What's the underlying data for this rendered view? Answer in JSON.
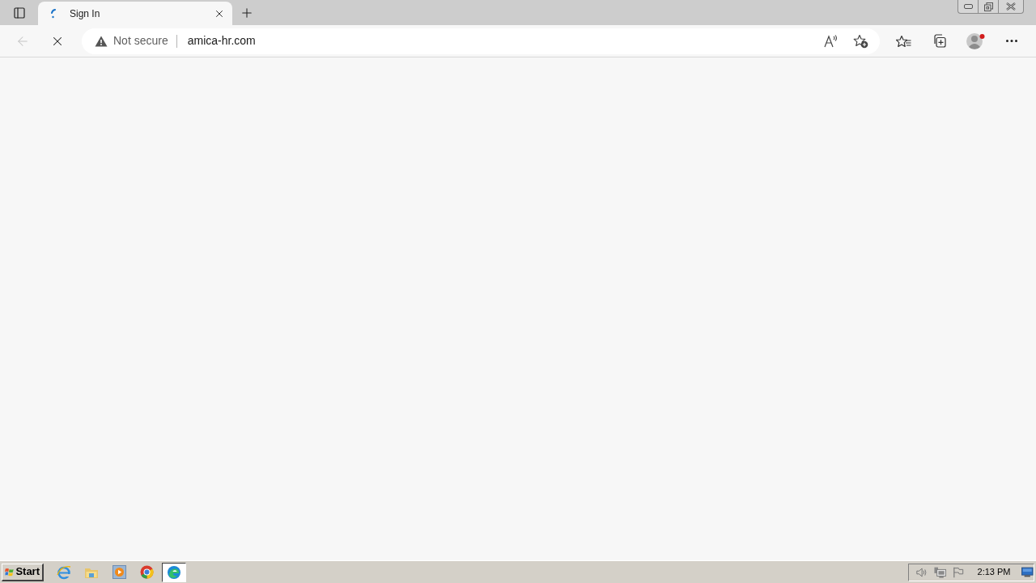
{
  "browser": {
    "tabs": [
      {
        "title": "Sign In",
        "selected": true,
        "loading": true
      }
    ],
    "navigation": {
      "back_disabled": true,
      "loading": true
    },
    "address_bar": {
      "security_label": "Not secure",
      "url": "amica-hr.com"
    }
  },
  "taskbar": {
    "start_label": "Start",
    "apps": [
      {
        "kind": "ie",
        "selected": false
      },
      {
        "kind": "explorer",
        "selected": false
      },
      {
        "kind": "media",
        "selected": false
      },
      {
        "kind": "chrome",
        "selected": false
      },
      {
        "kind": "edge",
        "selected": true
      }
    ],
    "clock": "2:13 PM"
  }
}
